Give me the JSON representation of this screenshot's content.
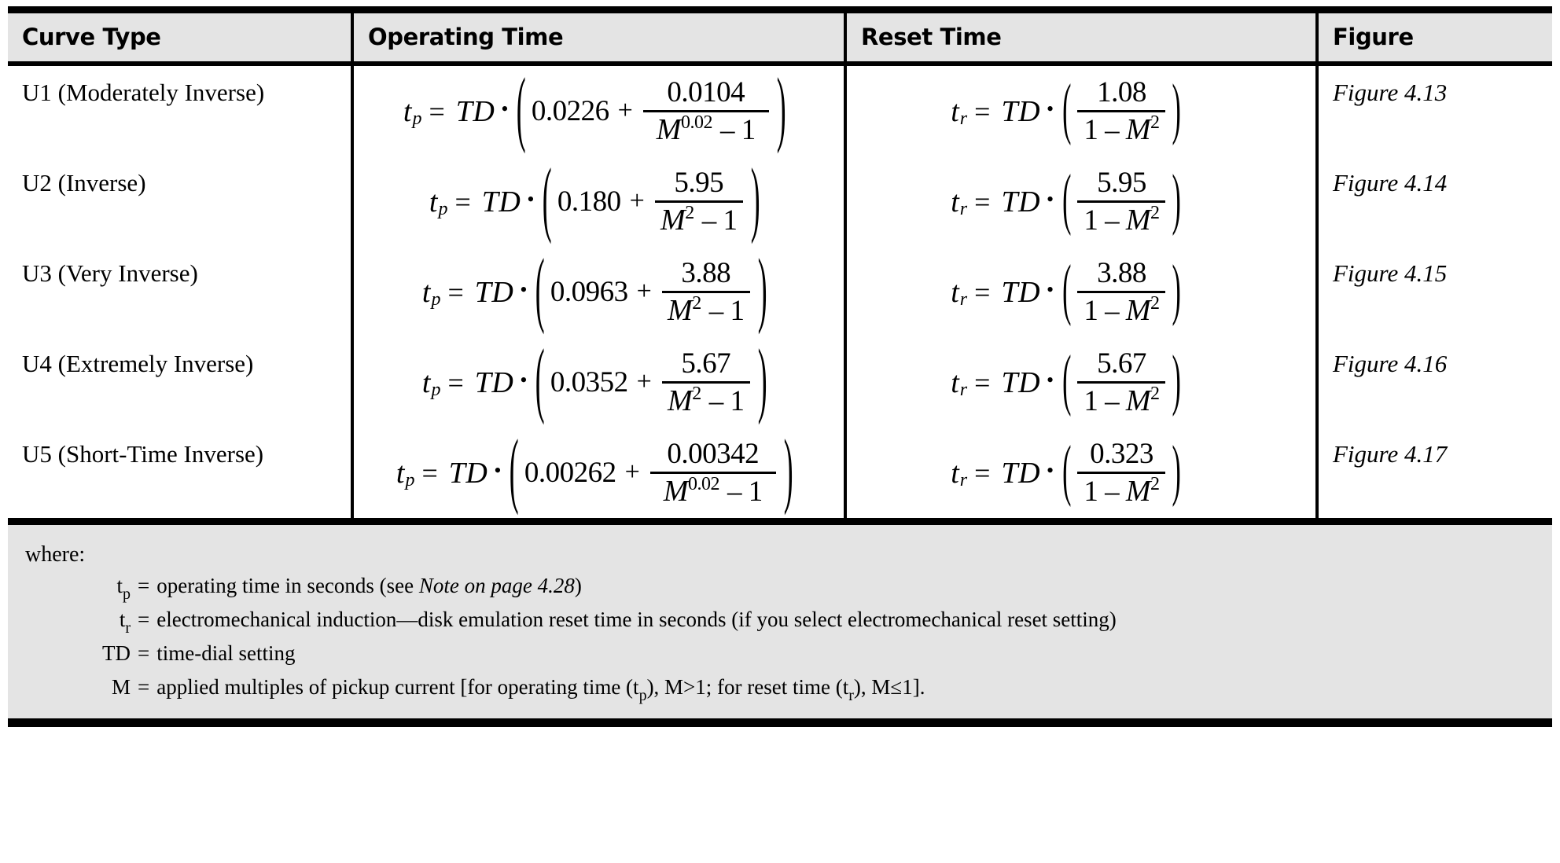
{
  "table": {
    "headers": {
      "curve_type": "Curve Type",
      "operating_time": "Operating Time",
      "reset_time": "Reset Time",
      "figure": "Figure"
    },
    "rows": [
      {
        "curve_type": "U1 (Moderately Inverse)",
        "operating": {
          "lhs_var": "t",
          "lhs_sub": "p",
          "equals": "=",
          "td": "TD",
          "dot": "•",
          "constant": "0.0226",
          "plus": "+",
          "numerator": "0.0104",
          "den_base": "M",
          "den_exp": "0.02",
          "den_tail": "– 1"
        },
        "reset": {
          "lhs_var": "t",
          "lhs_sub": "r",
          "equals": "=",
          "td": "TD",
          "dot": "•",
          "numerator": "1.08",
          "den_lead": "1 –",
          "den_base": "M",
          "den_exp": "2"
        },
        "figure": "Figure 4.13"
      },
      {
        "curve_type": "U2 (Inverse)",
        "operating": {
          "lhs_var": "t",
          "lhs_sub": "p",
          "equals": "=",
          "td": "TD",
          "dot": "•",
          "constant": "0.180",
          "plus": "+",
          "numerator": "5.95",
          "den_base": "M",
          "den_exp": "2",
          "den_tail": "– 1"
        },
        "reset": {
          "lhs_var": "t",
          "lhs_sub": "r",
          "equals": "=",
          "td": "TD",
          "dot": "•",
          "numerator": "5.95",
          "den_lead": "1 –",
          "den_base": "M",
          "den_exp": "2"
        },
        "figure": "Figure 4.14"
      },
      {
        "curve_type": "U3 (Very Inverse)",
        "operating": {
          "lhs_var": "t",
          "lhs_sub": "p",
          "equals": "=",
          "td": "TD",
          "dot": "•",
          "constant": "0.0963",
          "plus": "+",
          "numerator": "3.88",
          "den_base": "M",
          "den_exp": "2",
          "den_tail": "– 1"
        },
        "reset": {
          "lhs_var": "t",
          "lhs_sub": "r",
          "equals": "=",
          "td": "TD",
          "dot": "•",
          "numerator": "3.88",
          "den_lead": "1 –",
          "den_base": "M",
          "den_exp": "2"
        },
        "figure": "Figure 4.15"
      },
      {
        "curve_type": "U4 (Extremely Inverse)",
        "operating": {
          "lhs_var": "t",
          "lhs_sub": "p",
          "equals": "=",
          "td": "TD",
          "dot": "•",
          "constant": "0.0352",
          "plus": "+",
          "numerator": "5.67",
          "den_base": "M",
          "den_exp": "2",
          "den_tail": "– 1"
        },
        "reset": {
          "lhs_var": "t",
          "lhs_sub": "r",
          "equals": "=",
          "td": "TD",
          "dot": "•",
          "numerator": "5.67",
          "den_lead": "1 –",
          "den_base": "M",
          "den_exp": "2"
        },
        "figure": "Figure 4.16"
      },
      {
        "curve_type": "U5 (Short-Time Inverse)",
        "operating": {
          "lhs_var": "t",
          "lhs_sub": "p",
          "equals": "=",
          "td": "TD",
          "dot": "•",
          "constant": "0.00262",
          "plus": "+",
          "numerator": "0.00342",
          "den_base": "M",
          "den_exp": "0.02",
          "den_tail": "– 1"
        },
        "reset": {
          "lhs_var": "t",
          "lhs_sub": "r",
          "equals": "=",
          "td": "TD",
          "dot": "•",
          "numerator": "0.323",
          "den_lead": "1 –",
          "den_base": "M",
          "den_exp": "2"
        },
        "figure": "Figure 4.17"
      }
    ]
  },
  "note": {
    "heading": "where:",
    "definitions": [
      {
        "symbol": "t",
        "symbol_sub": "p",
        "equals": "=",
        "text_before_italic": "operating time in seconds (see ",
        "italic_text": "Note on page 4.28",
        "text_after_italic": ")"
      },
      {
        "symbol": "t",
        "symbol_sub": "r",
        "equals": "=",
        "text_before_italic": "electromechanical induction—disk emulation reset time in seconds (if you select electromechanical reset setting)",
        "italic_text": "",
        "text_after_italic": ""
      },
      {
        "symbol": "TD",
        "symbol_sub": "",
        "equals": "=",
        "text_before_italic": "time-dial setting",
        "italic_text": "",
        "text_after_italic": ""
      },
      {
        "symbol": "M",
        "symbol_sub": "",
        "equals": "=",
        "text_before_italic": "applied multiples of pickup current [for operating time (t",
        "italic_text": "",
        "text_after_italic": ""
      }
    ],
    "m_line": {
      "sub1": "p",
      "mid": "), M>1; for reset time (t",
      "sub2": "r",
      "tail": "), M≤1]."
    }
  },
  "colors": {
    "header_bg": "#e4e4e4",
    "note_bg": "#e4e4e4",
    "rule": "#000000",
    "page_bg": "#ffffff"
  }
}
